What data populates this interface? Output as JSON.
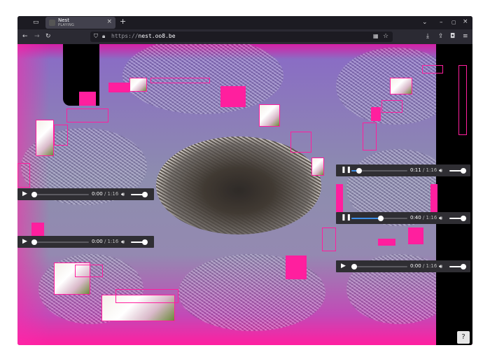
{
  "browser": {
    "tab": {
      "title": "Nest",
      "status": "PLAYING",
      "close_icon": "close-icon"
    },
    "new_tab_icon": "plus-icon",
    "url": {
      "scheme": "https://",
      "host": "nest.oo8.be"
    },
    "icons": [
      "back-arrow-icon",
      "forward-arrow-icon",
      "reload-icon",
      "shield-icon",
      "lock-icon",
      "qr-icon",
      "star-icon",
      "download-icon",
      "share-icon",
      "extension-icon",
      "menu-icon"
    ]
  },
  "players": [
    {
      "id": "left-top",
      "state": "paused",
      "current": "0:00",
      "total": "1:16",
      "progress": 0.0
    },
    {
      "id": "left-bottom",
      "state": "paused",
      "current": "0:00",
      "total": "1:16",
      "progress": 0.0
    },
    {
      "id": "right-1",
      "state": "playing",
      "current": "0:11",
      "total": "1:16",
      "progress": 0.14
    },
    {
      "id": "right-2",
      "state": "playing",
      "current": "0:40",
      "total": "1:16",
      "progress": 0.53
    },
    {
      "id": "right-3",
      "state": "paused",
      "current": "0:00",
      "total": "1:16",
      "progress": 0.0
    }
  ],
  "help": {
    "label": "?"
  },
  "colors": {
    "accent_pink": "#ff1f9e",
    "progress_blue": "#3c8ee8",
    "chrome_dark": "#1c1b22"
  }
}
